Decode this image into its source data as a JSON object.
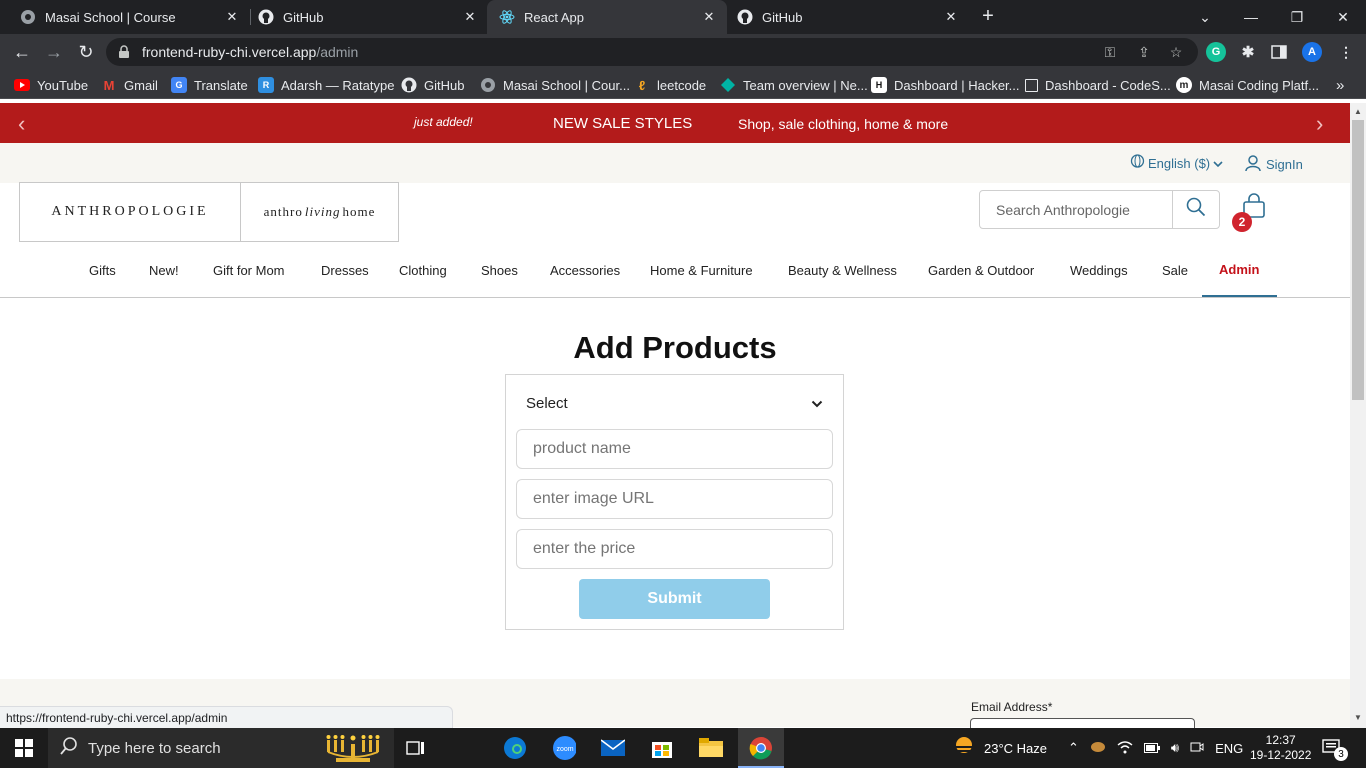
{
  "browser": {
    "tabs": [
      {
        "title": "Masai School | Course",
        "icon": "masai-icon"
      },
      {
        "title": "GitHub",
        "icon": "github-icon"
      },
      {
        "title": "React App",
        "icon": "react-icon"
      },
      {
        "title": "GitHub",
        "icon": "github-icon"
      }
    ],
    "url_host": "frontend-ruby-chi.vercel.app",
    "url_path": "/admin",
    "profile_initial": "A",
    "bookmarks": [
      {
        "label": "YouTube",
        "color": "#ff0000"
      },
      {
        "label": "Gmail",
        "color": "#ea4335"
      },
      {
        "label": "Translate",
        "color": "#4285f4"
      },
      {
        "label": "Adarsh — Ratatype",
        "color": "#2f8fe0"
      },
      {
        "label": "GitHub",
        "color": "#ffffff"
      },
      {
        "label": "Masai School | Cour...",
        "color": "#9aa0a6"
      },
      {
        "label": "leetcode",
        "color": "#f5a623"
      },
      {
        "label": "Team overview | Ne...",
        "color": "#00b3a4"
      },
      {
        "label": "Dashboard | Hacker...",
        "color": "#111111"
      },
      {
        "label": "Dashboard - CodeS...",
        "color": "#ffffff"
      },
      {
        "label": "Masai Coding Platf...",
        "color": "#ffffff"
      }
    ],
    "status_url": "https://frontend-ruby-chi.vercel.app/admin"
  },
  "promo": {
    "just_added": "just added!",
    "sale": "NEW SALE STYLES",
    "shop": "Shop, sale clothing, home & more"
  },
  "utility": {
    "language": "English ($)",
    "signin": "SignIn"
  },
  "header": {
    "logo_main": "ANTHROPOLOGIE",
    "logo_home_left": "anthro",
    "logo_home_script": "living",
    "logo_home_right": "home",
    "search_placeholder": "Search Anthropologie",
    "cart_count": "2"
  },
  "nav": {
    "items": [
      "Gifts",
      "New!",
      "Gift for Mom",
      "Dresses",
      "Clothing",
      "Shoes",
      "Accessories",
      "Home & Furniture",
      "Beauty & Wellness",
      "Garden & Outdoor",
      "Weddings",
      "Sale",
      "Admin"
    ]
  },
  "form": {
    "title": "Add Products",
    "select_value": "Select",
    "name_placeholder": "product name",
    "image_placeholder": "enter image URL",
    "price_placeholder": "enter the price",
    "submit_label": "Submit"
  },
  "footer": {
    "email_label": "Email Address*"
  },
  "taskbar": {
    "search_placeholder": "Type here to search",
    "weather": "23°C  Haze",
    "lang": "ENG",
    "time": "12:37",
    "date": "19-12-2022",
    "notifications": "3"
  },
  "colors": {
    "promo_red": "#b31b1b",
    "link_blue": "#2f6f93",
    "admin_red": "#c4121a",
    "submit_blue": "#90cdea"
  }
}
